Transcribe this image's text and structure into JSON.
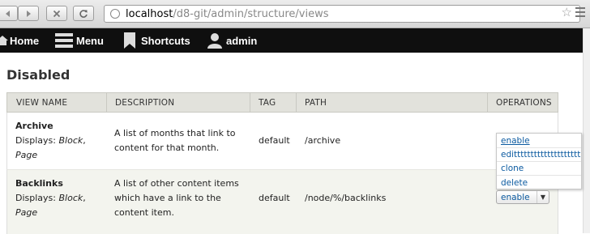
{
  "browser": {
    "url_host": "localhost",
    "url_path": "/d8-git/admin/structure/views"
  },
  "toolbar": {
    "items": [
      {
        "label": "Home",
        "icon": "home-icon"
      },
      {
        "label": "Menu",
        "icon": "menu-icon"
      },
      {
        "label": "Shortcuts",
        "icon": "bookmark-icon"
      },
      {
        "label": "admin",
        "icon": "user-icon"
      }
    ]
  },
  "section": {
    "title": "Disabled"
  },
  "table": {
    "headers": [
      "VIEW NAME",
      "DESCRIPTION",
      "TAG",
      "PATH",
      "OPERATIONS"
    ],
    "rows": [
      {
        "name": "Archive",
        "displays_prefix": "Displays: ",
        "display_a": "Block",
        "display_sep": ",",
        "display_b": "Page",
        "description_1": "A list of months that link to",
        "description_2": "content for that month.",
        "tag": "default",
        "path": "/archive"
      },
      {
        "name": "Backlinks",
        "displays_prefix": "Displays: ",
        "display_a": "Block",
        "display_sep": ",",
        "display_b": "Page",
        "description_1": "A list of other content items",
        "description_2": "which have a link to the",
        "description_3": "content item.",
        "tag": "default",
        "path": "/node/%/backlinks"
      }
    ]
  },
  "operations": {
    "button_label": "enable",
    "menu": [
      "enable",
      "editttttttttttttttttttt",
      "clone",
      "delete"
    ]
  },
  "colors": {
    "toolbar_bg": "#0f0f0f",
    "header_bg": "#e2e2dc",
    "link": "#0b5aa0",
    "alt_row": "#f3f4ee"
  }
}
